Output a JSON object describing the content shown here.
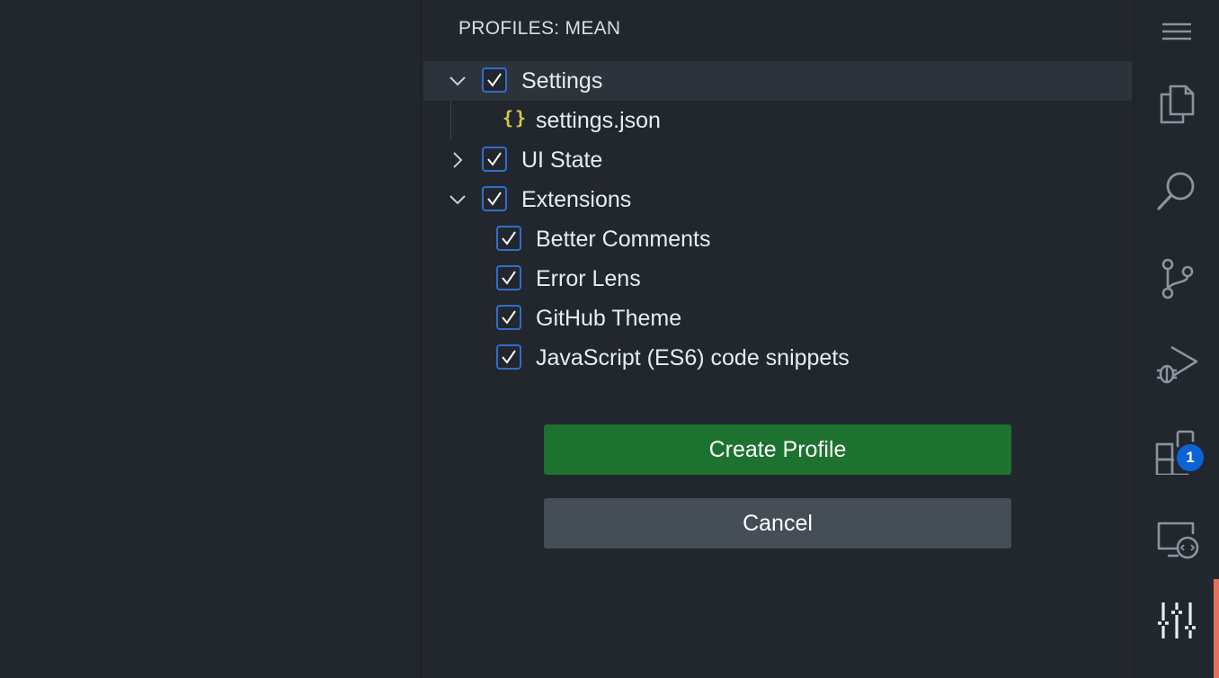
{
  "panel": {
    "title": "PROFILES: MEAN"
  },
  "tree": {
    "settings": {
      "label": "Settings",
      "checked": true,
      "expanded": true
    },
    "settings_json": {
      "icon": "json-braces-icon",
      "glyph": "{}",
      "label": "settings.json"
    },
    "ui_state": {
      "label": "UI State",
      "checked": true,
      "expanded": false
    },
    "extensions": {
      "label": "Extensions",
      "checked": true,
      "expanded": true
    },
    "extension_items": [
      {
        "label": "Better Comments",
        "checked": true
      },
      {
        "label": "Error Lens",
        "checked": true
      },
      {
        "label": "GitHub Theme",
        "checked": true
      },
      {
        "label": "JavaScript (ES6) code snippets",
        "checked": true
      }
    ]
  },
  "buttons": {
    "create": "Create Profile",
    "cancel": "Cancel"
  },
  "activity_bar": {
    "items": [
      "menu-icon",
      "explorer-icon",
      "search-icon",
      "source-control-icon",
      "run-debug-icon",
      "extensions-icon",
      "remote-explorer-icon",
      "settings-sliders-icon"
    ],
    "extensions_badge": "1"
  },
  "colors": {
    "accent": "#316dca",
    "primary_button": "#1d7230",
    "secondary_button": "#454d57",
    "badge": "#0a63d8",
    "active_indicator": "#e0725e"
  }
}
